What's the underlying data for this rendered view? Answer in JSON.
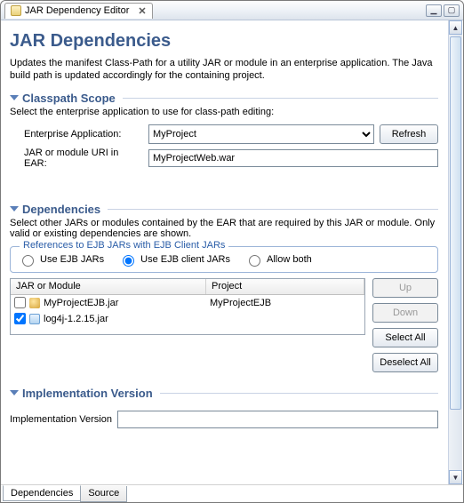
{
  "titlebar": {
    "tab_label": "JAR Dependency Editor",
    "close_glyph": "✕",
    "min_glyph": "▁",
    "max_glyph": "▢"
  },
  "page": {
    "title": "JAR Dependencies",
    "description": "Updates the manifest Class-Path for a utility JAR or module in an enterprise application.  The Java build path is updated accordingly for the containing project."
  },
  "classpath_scope": {
    "section_title": "Classpath Scope",
    "section_desc": "Select the enterprise application to use for class-path editing:",
    "enterprise_label": "Enterprise Application:",
    "enterprise_value": "MyProject",
    "refresh_label": "Refresh",
    "jar_uri_label": "JAR or module URI in EAR:",
    "jar_uri_value": "MyProjectWeb.war"
  },
  "dependencies": {
    "section_title": "Dependencies",
    "section_desc": "Select other JARs or modules contained by the EAR that are required by this JAR or module.  Only valid or existing dependencies are shown.",
    "groupbox_title": "References to EJB JARs with EJB Client JARs",
    "radio_use_ejb": "Use EJB JARs",
    "radio_use_client": "Use EJB client JARs",
    "radio_allow_both": "Allow both",
    "selected_radio": "client",
    "table": {
      "col1": "JAR or Module",
      "col2": "Project",
      "rows": [
        {
          "checked": false,
          "icon": "ejb",
          "name": "MyProjectEJB.jar",
          "project": "MyProjectEJB"
        },
        {
          "checked": true,
          "icon": "jar",
          "name": "log4j-1.2.15.jar",
          "project": ""
        }
      ]
    },
    "buttons": {
      "up": "Up",
      "down": "Down",
      "select_all": "Select All",
      "deselect_all": "Deselect All"
    }
  },
  "implementation": {
    "section_title": "Implementation Version",
    "label": "Implementation Version",
    "value": ""
  },
  "bottom_tabs": {
    "dependencies": "Dependencies",
    "source": "Source"
  }
}
